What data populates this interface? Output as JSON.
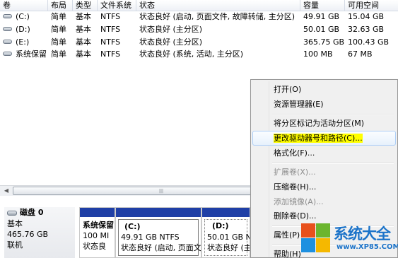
{
  "volume_list": {
    "columns": [
      "卷",
      "布局",
      "类型",
      "文件系统",
      "状态",
      "容量",
      "可用空间"
    ],
    "rows": [
      {
        "volume": "(C:)",
        "layout": "简单",
        "type": "基本",
        "fs": "NTFS",
        "status": "状态良好 (启动, 页面文件, 故障转储, 主分区)",
        "capacity": "49.91 GB",
        "free": "15.04 GB"
      },
      {
        "volume": "(D:)",
        "layout": "简单",
        "type": "基本",
        "fs": "NTFS",
        "status": "状态良好 (主分区)",
        "capacity": "50.01 GB",
        "free": "32.63 GB"
      },
      {
        "volume": "(E:)",
        "layout": "简单",
        "type": "基本",
        "fs": "NTFS",
        "status": "状态良好 (主分区)",
        "capacity": "365.75 GB",
        "free": "100.43 GB"
      },
      {
        "volume": "系统保留",
        "layout": "简单",
        "type": "基本",
        "fs": "NTFS",
        "status": "状态良好 (系统, 活动, 主分区)",
        "capacity": "100 MB",
        "free": "67 MB"
      }
    ]
  },
  "scrollbar": {
    "left_arrow": "◀",
    "right_arrow": "▶",
    "grip": "|||"
  },
  "disk": {
    "name": "磁盘 0",
    "type": "基本",
    "size": "465.76 GB",
    "status": "联机"
  },
  "partitions": [
    {
      "title": "系统保留",
      "line2": "100 MI",
      "line3": "状态良"
    },
    {
      "title": "(C:)",
      "line2": "49.91 GB NTFS",
      "line3": "状态良好 (启动, 页面文"
    },
    {
      "title": "(D:)",
      "line2": "50.01 GB NT",
      "line3": "状态良好 (主"
    }
  ],
  "context_menu": {
    "items": [
      {
        "label": "打开(O)",
        "disabled": false
      },
      {
        "label": "资源管理器(E)",
        "disabled": false
      },
      {
        "label": "将分区标记为活动分区(M)",
        "disabled": false
      },
      {
        "label": "更改驱动器号和路径(C)...",
        "disabled": false,
        "highlighted": true
      },
      {
        "label": "格式化(F)...",
        "disabled": false
      },
      {
        "label": "扩展卷(X)...",
        "disabled": true
      },
      {
        "label": "压缩卷(H)...",
        "disabled": false
      },
      {
        "label": "添加镜像(A)...",
        "disabled": true
      },
      {
        "label": "删除卷(D)...",
        "disabled": false
      },
      {
        "label": "属性(P)",
        "disabled": false
      },
      {
        "label": "帮助(H)",
        "disabled": false
      }
    ]
  },
  "watermark": {
    "brand": "系统大全",
    "url": "www.XP85.COM"
  },
  "colors": {
    "partition_bar": "#1f3fa6",
    "highlight_text_bg": "#ffff00",
    "watermark_blue": "#1b73c9"
  }
}
